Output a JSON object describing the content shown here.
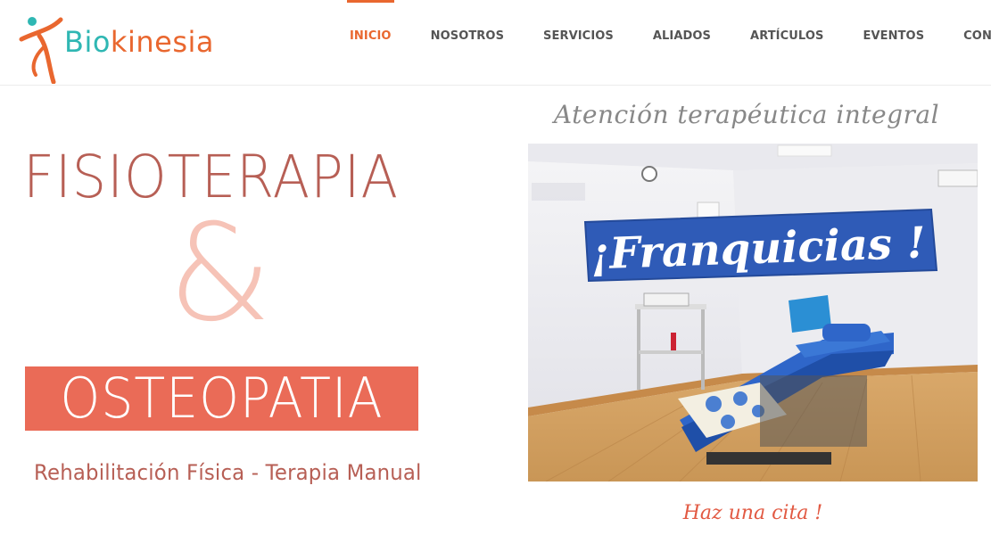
{
  "brand": {
    "logo_text_prefix": "Bio",
    "logo_text_suffix": "kinesia",
    "colors": {
      "orange": "#e9672f",
      "teal": "#2fb7b3"
    }
  },
  "nav": {
    "items": [
      {
        "label": "INICIO",
        "active": true
      },
      {
        "label": "NOSOTROS",
        "active": false
      },
      {
        "label": "SERVICIOS",
        "active": false
      },
      {
        "label": "ALIADOS",
        "active": false
      },
      {
        "label": "ARTÍCULOS",
        "active": false
      },
      {
        "label": "EVENTOS",
        "active": false
      },
      {
        "label": "CONTACTO",
        "active": false
      }
    ]
  },
  "hero": {
    "title_1": "FISIOTERAPIA",
    "ampersand": "&",
    "title_2": "OSTEOPATIA",
    "subtitle": "Rehabilitación Física - Terapia Manual",
    "colors": {
      "title": "#b75f55",
      "ampersand": "#f6c3b7",
      "box": "#ea6b57"
    }
  },
  "side": {
    "tagline": "Atención terapéutica integral",
    "banner_text": "¡Franquicias !",
    "cta": "Haz una cita !"
  }
}
